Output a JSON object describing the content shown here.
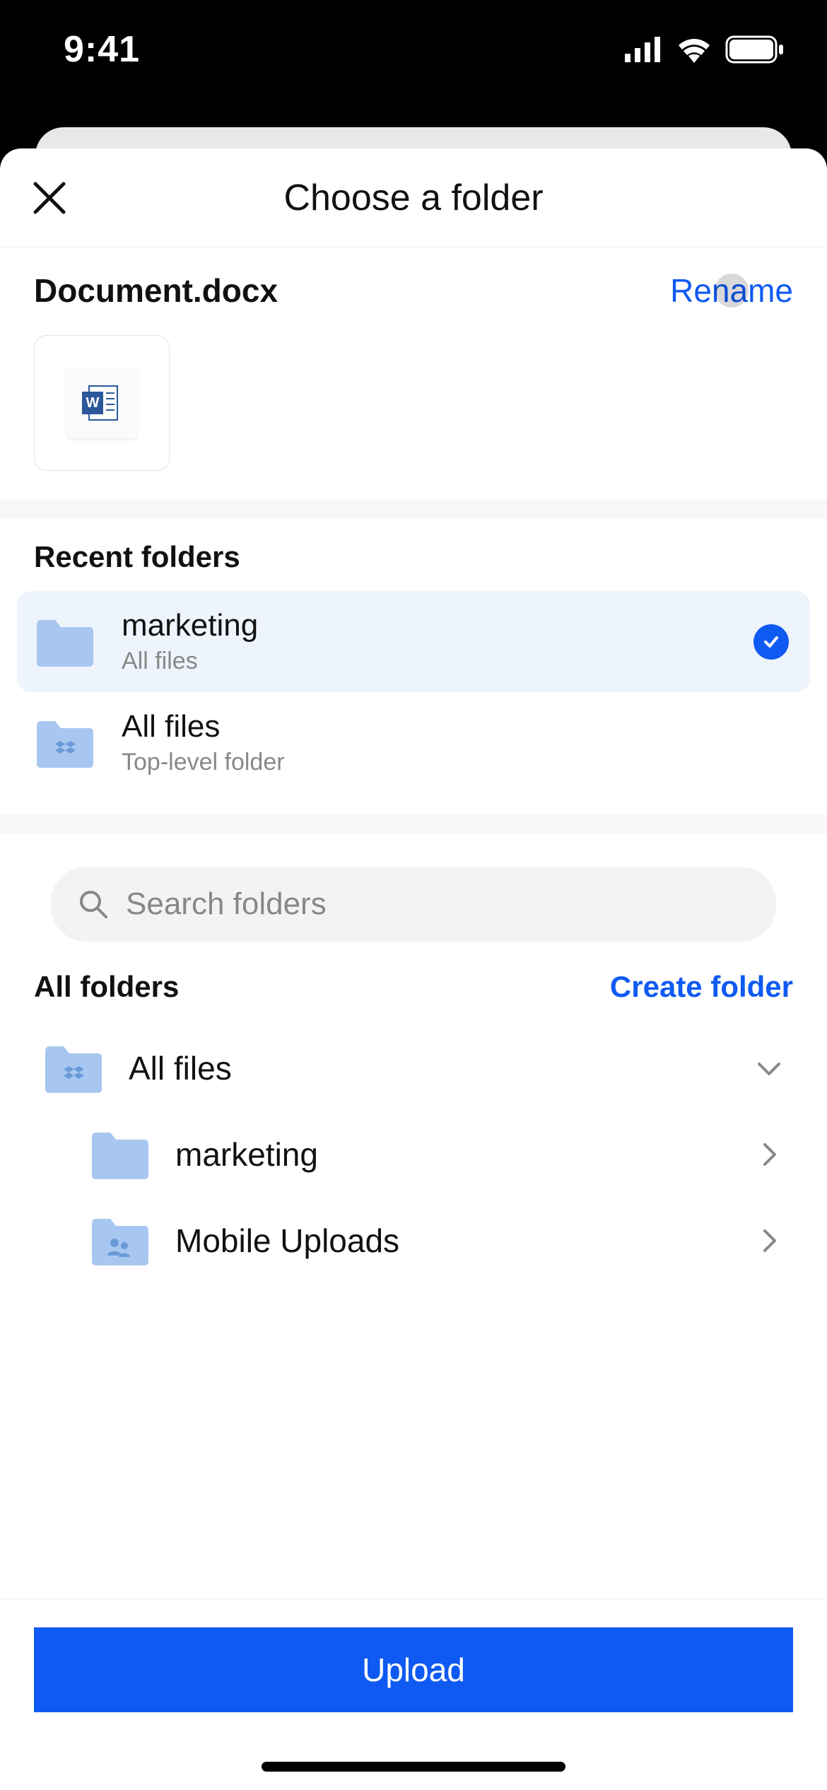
{
  "status": {
    "time": "9:41"
  },
  "sheet": {
    "title": "Choose a folder"
  },
  "file": {
    "name": "Document.docx",
    "rename_label": "Rename"
  },
  "recent": {
    "section_label": "Recent folders",
    "items": [
      {
        "title": "marketing",
        "subtitle": "All files",
        "selected": true
      },
      {
        "title": "All files",
        "subtitle": "Top-level folder",
        "selected": false
      }
    ]
  },
  "search": {
    "placeholder": "Search folders"
  },
  "all_folders": {
    "label": "All folders",
    "create_label": "Create folder",
    "tree": [
      {
        "title": "All files",
        "icon": "dropbox",
        "expandable": true
      },
      {
        "title": "marketing",
        "icon": "folder",
        "indent": true
      },
      {
        "title": "Mobile Uploads",
        "icon": "shared-folder",
        "indent": true
      }
    ]
  },
  "footer": {
    "upload_label": "Upload"
  },
  "colors": {
    "accent": "#0f5af2",
    "folder": "#a8c7f0"
  }
}
